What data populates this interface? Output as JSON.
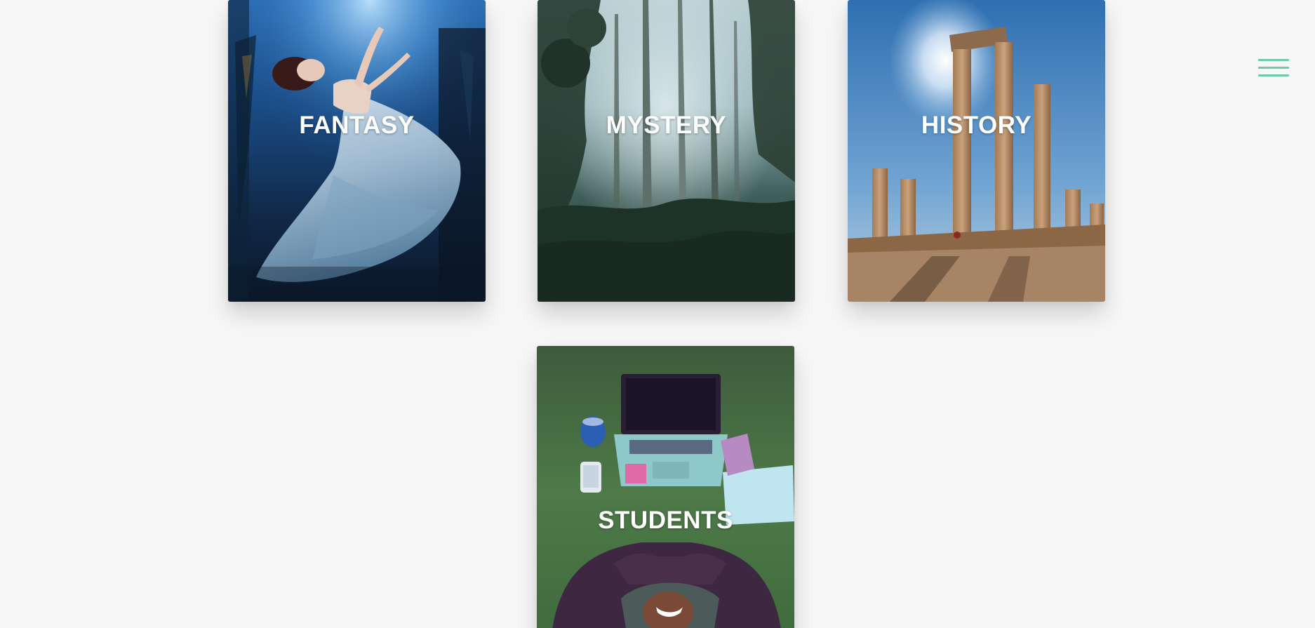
{
  "menu": {
    "icon": "hamburger-menu-icon",
    "accent_color": "#6ccca8"
  },
  "genres": [
    {
      "label": "FANTASY"
    },
    {
      "label": "MYSTERY"
    },
    {
      "label": "HISTORY"
    },
    {
      "label": "STUDENTS"
    }
  ]
}
